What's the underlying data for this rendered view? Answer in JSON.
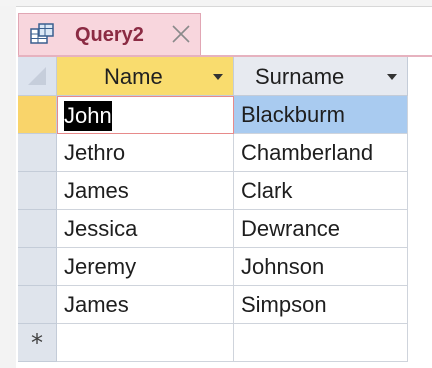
{
  "tab": {
    "title": "Query2",
    "icon": "query-datasheet-icon",
    "close_icon": "close-icon"
  },
  "columns": [
    {
      "label": "Name",
      "dropdown_icon": "chevron-down-icon"
    },
    {
      "label": "Surname",
      "dropdown_icon": "chevron-down-icon"
    }
  ],
  "rows": [
    {
      "name": "John",
      "surname": "Blackburm"
    },
    {
      "name": "Jethro",
      "surname": "Chamberland"
    },
    {
      "name": "James",
      "surname": "Clark"
    },
    {
      "name": "Jessica",
      "surname": "Dewrance"
    },
    {
      "name": "Jeremy",
      "surname": "Johnson"
    },
    {
      "name": "James",
      "surname": "Simpson"
    }
  ],
  "new_record_marker": "*",
  "colors": {
    "tab_bg": "#f8d6dd",
    "tab_text": "#8b2b43",
    "active_header": "#f9dc6e",
    "selected_cell": "#a9cbf0",
    "active_row_selector": "#f9d46a"
  }
}
